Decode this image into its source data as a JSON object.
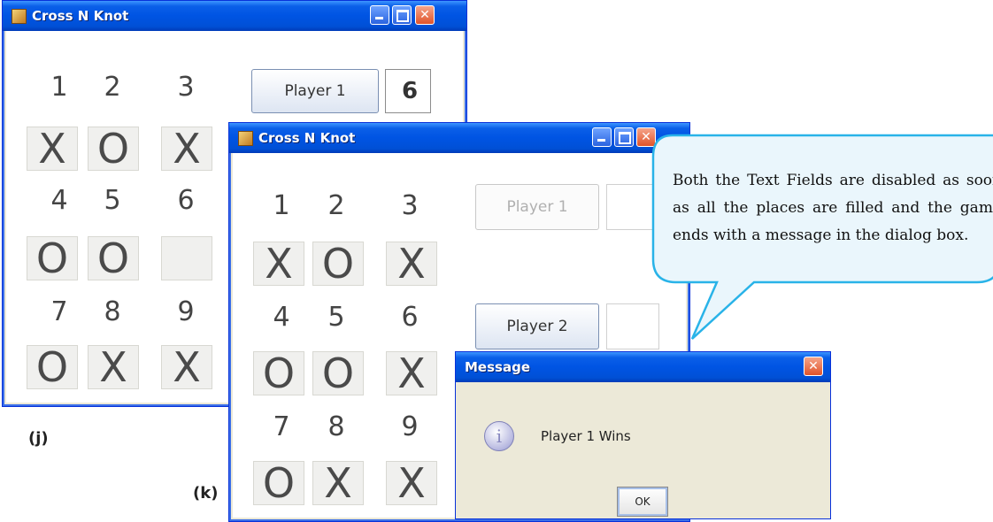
{
  "window_j": {
    "title": "Cross N Knot",
    "numbers": [
      "1",
      "2",
      "3",
      "4",
      "5",
      "6",
      "7",
      "8",
      "9"
    ],
    "cells": [
      "X",
      "O",
      "X",
      "O",
      "O",
      "",
      "O",
      "X",
      "X"
    ],
    "player1_label": "Player 1",
    "player1_value": "6"
  },
  "window_k": {
    "title": "Cross N Knot",
    "numbers": [
      "1",
      "2",
      "3",
      "4",
      "5",
      "6",
      "7",
      "8",
      "9"
    ],
    "cells": [
      "X",
      "O",
      "X",
      "O",
      "O",
      "X",
      "O",
      "X",
      "X"
    ],
    "player1_label": "Player 1",
    "player2_label": "Player 2"
  },
  "captions": {
    "j": "(j)",
    "k": "(k)"
  },
  "callout": "Both the Text Fields are disabled as soon as all the places are filled and the game ends with a message in the dialog box.",
  "message_dialog": {
    "title": "Message",
    "text": "Player 1 Wins",
    "ok_label": "OK",
    "icon": "info-icon"
  },
  "colors": {
    "titlebar": "#0054e3",
    "close_button": "#e0542a",
    "callout_fill": "#eaf6fc",
    "callout_border": "#29b3e8"
  }
}
